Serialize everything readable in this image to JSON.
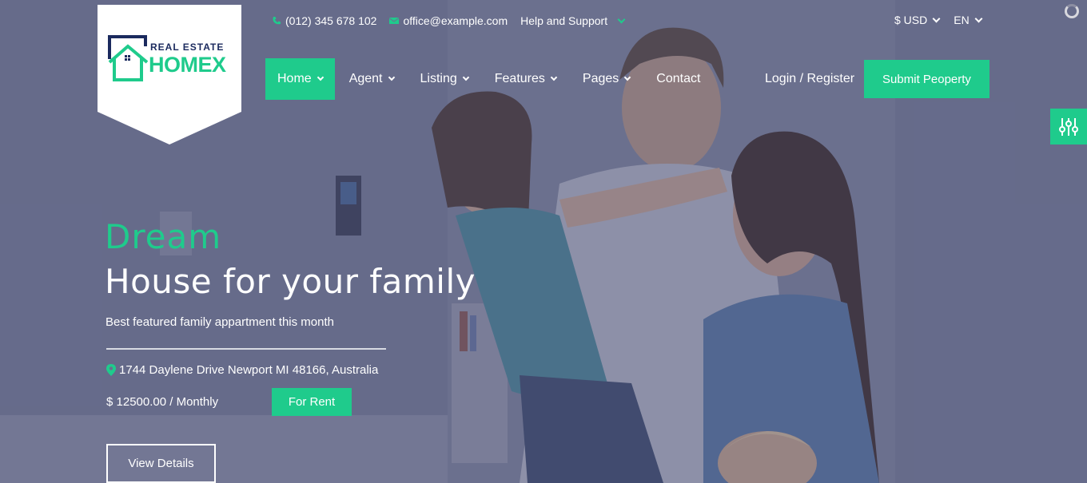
{
  "brand": {
    "top": "REAL ESTATE",
    "main": "HOMEX"
  },
  "topbar": {
    "phone": "(012) 345 678 102",
    "email": "office@example.com",
    "support": "Help and Support",
    "currency": "$ USD",
    "language": "EN"
  },
  "nav": {
    "items": [
      {
        "label": "Home"
      },
      {
        "label": "Agent"
      },
      {
        "label": "Listing"
      },
      {
        "label": "Features"
      },
      {
        "label": "Pages"
      },
      {
        "label": "Contact"
      }
    ],
    "login": "Login / Register",
    "submit": "Submit Peoperty"
  },
  "hero": {
    "kicker": "Dream",
    "title": "House for your family",
    "subtitle": "Best featured family appartment this month",
    "address": "1744 Daylene Drive Newport MI 48166, Australia",
    "price": "$ 12500.00 / Monthly",
    "tag": "For Rent",
    "cta": "View Details"
  },
  "colors": {
    "accent": "#1fcb8c",
    "brand_dark": "#1b2a5e"
  },
  "icons": [
    "phone-icon",
    "envelope-icon",
    "map-marker-icon",
    "settings-sliders-icon",
    "loader-icon",
    "house-logo-icon"
  ]
}
